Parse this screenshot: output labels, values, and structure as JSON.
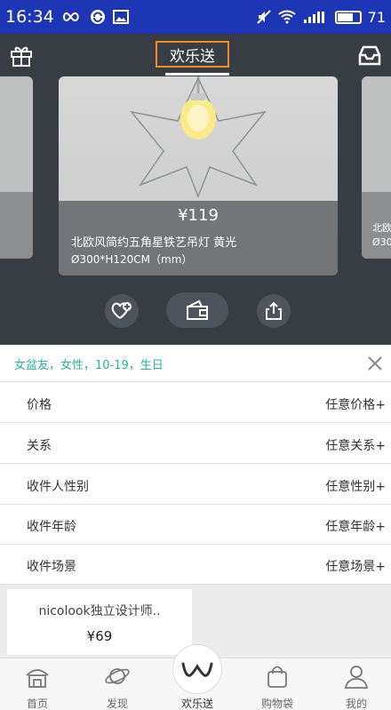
{
  "status_bar": {
    "time": "16:34",
    "battery": "71",
    "battery_level_percent": 71
  },
  "header": {
    "title": "欢乐送"
  },
  "carousel": {
    "main_card": {
      "price": "¥119",
      "name": "北欧风简约五角星铁艺吊灯 黄光",
      "size": "Ø300*H120CM（mm）"
    },
    "right_card": {
      "name_partial": "北欧",
      "size_partial": "Ø30"
    }
  },
  "filter": {
    "summary": "女盆友，女性，10-19，生日",
    "rows": [
      {
        "label": "价格",
        "value": "任意价格+"
      },
      {
        "label": "关系",
        "value": "任意关系+"
      },
      {
        "label": "收件人性别",
        "value": "任意性别+"
      },
      {
        "label": "收件年龄",
        "value": "任意年龄+"
      },
      {
        "label": "收件场景",
        "value": "任意场景+"
      }
    ]
  },
  "recommendation": {
    "name": "nicolook独立设计师..",
    "price": "¥69"
  },
  "nav": {
    "items": [
      {
        "label": "首页",
        "icon": "home-icon"
      },
      {
        "label": "发现",
        "icon": "planet-icon"
      },
      {
        "label": "欢乐送",
        "icon": "w-logo-icon"
      },
      {
        "label": "购物袋",
        "icon": "bag-icon"
      },
      {
        "label": "我的",
        "icon": "profile-icon"
      }
    ]
  },
  "colors": {
    "status_bar": "#1c36b6",
    "hero_background": "#383d44",
    "title_highlight": "#f08a2c",
    "summary_text": "#27b59b"
  }
}
